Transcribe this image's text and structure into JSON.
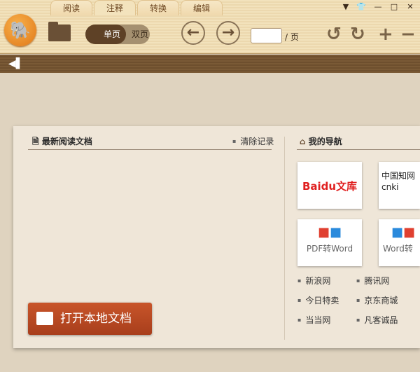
{
  "tabs": [
    "阅读",
    "注释",
    "转换",
    "编辑"
  ],
  "window_controls": [
    "menu",
    "skin",
    "minimize",
    "maximize",
    "close"
  ],
  "toolbar": {
    "single_page": "单页",
    "double_page": "双页",
    "page_input": "",
    "page_suffix": "/ 页"
  },
  "recent": {
    "title": "最新阅读文档",
    "clear": "清除记录",
    "open_button": "打开本地文档"
  },
  "nav": {
    "title": "我的导航",
    "tiles": [
      {
        "label": "Baidu文库",
        "logo": "baidu-wenku"
      },
      {
        "label": "中国知网 cnki",
        "logo": "cnki"
      },
      {
        "label": "PDF转Word",
        "logo": "pdf-to-word"
      },
      {
        "label": "Word转",
        "logo": "word-to-pdf"
      }
    ],
    "links": [
      [
        "新浪网",
        "腾讯网"
      ],
      [
        "今日特卖",
        "京东商城"
      ],
      [
        "当当网",
        "凡客诚品"
      ]
    ]
  },
  "colors": {
    "accent": "#b84a22",
    "toolbar": "#f0dcb2",
    "dark_bar": "#745432"
  }
}
